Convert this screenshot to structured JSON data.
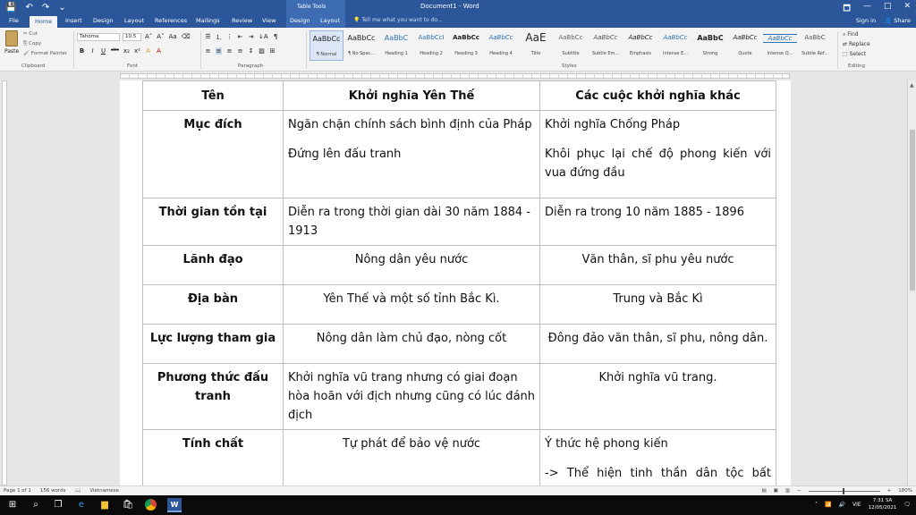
{
  "titlebar": {
    "document_title": "Document1 - Word",
    "context_group": "Table Tools",
    "qat": [
      "💾",
      "↶",
      "↷",
      "⌄"
    ],
    "window_buttons": [
      "🗖",
      "—",
      "□",
      "✕"
    ]
  },
  "tabs": {
    "items": [
      "File",
      "Home",
      "Insert",
      "Design",
      "Layout",
      "References",
      "Mailings",
      "Review",
      "View",
      "Design",
      "Layout"
    ],
    "active": "Home",
    "tell_me": "Tell me what you want to do...",
    "sign_in": "Sign in",
    "share": "Share"
  },
  "ribbon": {
    "clipboard": {
      "paste": "Paste",
      "cut": "Cut",
      "copy": "Copy",
      "format_painter": "Format Painter",
      "label": "Clipboard"
    },
    "font": {
      "name": "Tahoma",
      "size": "10.5",
      "label": "Font",
      "buttons": [
        "B",
        "I",
        "U",
        "abc",
        "x₂",
        "x²",
        "A",
        "A"
      ]
    },
    "paragraph": {
      "label": "Paragraph",
      "buttons": [
        "≡",
        "≡",
        "≡",
        "≡",
        "↕",
        "¶"
      ]
    },
    "styles": {
      "label": "Styles",
      "items": [
        {
          "sample": "AaBbCc",
          "name": "¶ Normal"
        },
        {
          "sample": "AaBbCc",
          "name": "¶ No Spac..."
        },
        {
          "sample": "AaBbC",
          "name": "Heading 1"
        },
        {
          "sample": "AaBbCcI",
          "name": "Heading 2"
        },
        {
          "sample": "AaBbCc",
          "name": "Heading 3"
        },
        {
          "sample": "AaBbCc",
          "name": "Heading 4"
        },
        {
          "sample": "AaE",
          "name": "Title"
        },
        {
          "sample": "AaBbCc",
          "name": "Subtitle"
        },
        {
          "sample": "AaBbCc",
          "name": "Subtle Em..."
        },
        {
          "sample": "AaBbCc",
          "name": "Emphasis"
        },
        {
          "sample": "AaBbCc",
          "name": "Intense E..."
        },
        {
          "sample": "AaBbC",
          "name": "Strong"
        },
        {
          "sample": "AaBbCc",
          "name": "Quote"
        },
        {
          "sample": "AaBbCc",
          "name": "Intense Q..."
        },
        {
          "sample": "AaBbC",
          "name": "Subtle Ref..."
        }
      ]
    },
    "editing": {
      "label": "Editing",
      "find": "Find",
      "replace": "Replace",
      "select": "Select"
    }
  },
  "table": {
    "headers": [
      "Tên",
      "Khởi nghĩa Yên Thế",
      "Các cuộc khởi nghĩa khác"
    ],
    "rows": [
      {
        "label": "Mục đích",
        "c1": [
          "Ngăn chặn chính sách bình định của Pháp",
          "Đứng lên đấu tranh"
        ],
        "c2": [
          "Khởi nghĩa Chống Pháp",
          "Khôi phục lại chế độ phong kiến với vua đứng đầu"
        ]
      },
      {
        "label": "Thời gian tồn tại",
        "c1": [
          "Diễn ra trong thời gian dài 30 năm 1884 - 1913"
        ],
        "c2": [
          "Diễn ra trong 10 năm 1885 - 1896"
        ]
      },
      {
        "label": "Lãnh đạo",
        "c1": [
          "Nông dân yêu nước"
        ],
        "c2": [
          "Văn thân, sĩ phu yêu nước"
        ]
      },
      {
        "label": "Địa bàn",
        "c1": [
          "Yên Thế và một số tỉnh Bắc Kì."
        ],
        "c2": [
          "Trung và Bắc Kì"
        ]
      },
      {
        "label": "Lực lượng tham gia",
        "c1": [
          "Nông dân làm chủ đạo, nòng cốt"
        ],
        "c2": [
          "Đông đảo văn thân, sĩ phu, nông dân."
        ]
      },
      {
        "label": "Phương thức đấu tranh",
        "c1": [
          "Khởi nghĩa vũ trang nhưng có giai đoạn hòa hoãn với địch nhưng cũng có lúc đánh địch"
        ],
        "c2": [
          "Khởi nghĩa vũ trang."
        ]
      },
      {
        "label": "Tính chất",
        "c1": [
          "Tự phát để bảo vệ nước"
        ],
        "c2": [
          "Ý thức hệ phong kiến",
          "-> Thể hiện tinh thần dân tộc bất khuất,kiên cường"
        ]
      }
    ]
  },
  "statusbar": {
    "page": "Page 1 of 1",
    "words": "156 words",
    "language": "Vietnamese",
    "zoom": "180%"
  },
  "taskbar": {
    "lang": "VIE",
    "time": "7:31 SA",
    "date": "12/05/2021"
  },
  "colors": {
    "word_blue": "#2b579a",
    "ribbon_bg": "#f3f3f3",
    "canvas_bg": "#e6e6e6"
  }
}
